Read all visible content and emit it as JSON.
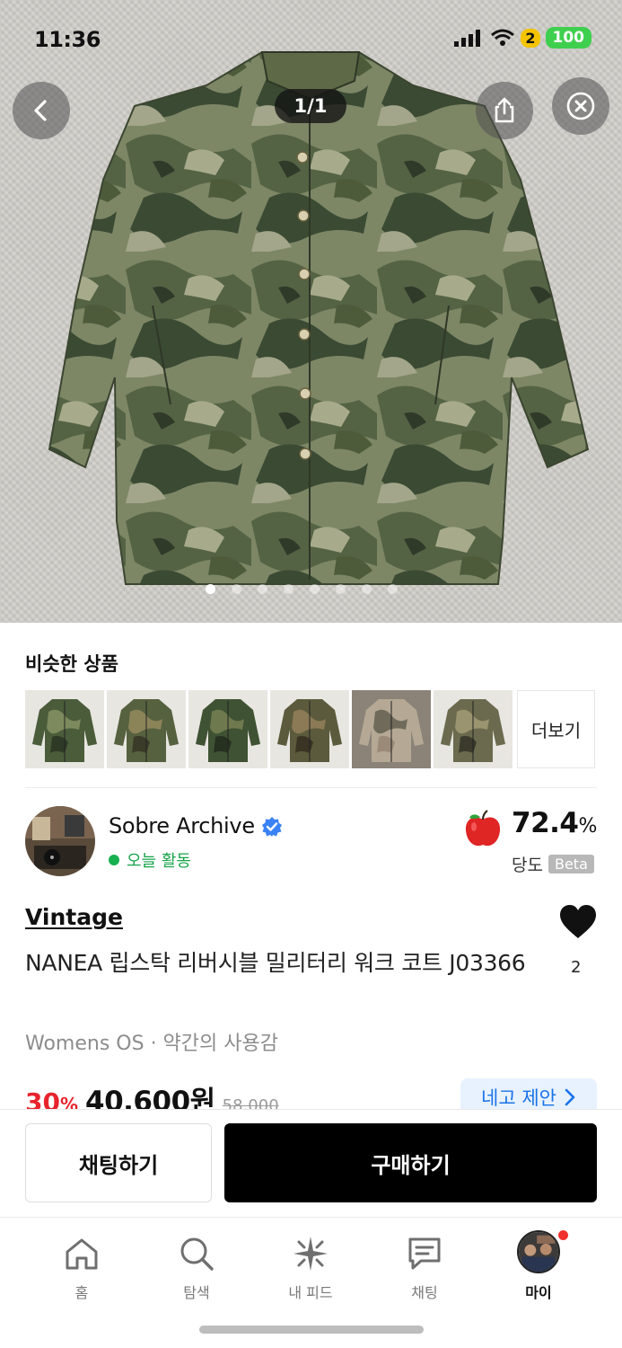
{
  "status_bar": {
    "time": "11:36",
    "battery": "100",
    "charge_badge": "2"
  },
  "gallery": {
    "counter": "1/1",
    "dots_total": 8,
    "active_dot": 0
  },
  "similar": {
    "title": "비슷한 상품",
    "more_label": "더보기",
    "thumb_colors": [
      [
        "#4a5c3a",
        "#7d8a5d",
        "#2f3a26"
      ],
      [
        "#56613f",
        "#8c8459",
        "#3a3b28"
      ],
      [
        "#3f5233",
        "#6e7a4e",
        "#273120"
      ],
      [
        "#5b5a3c",
        "#8b7a55",
        "#3a3424"
      ],
      [
        "#b5a995",
        "#6f6a5a",
        "#9c8a78"
      ],
      [
        "#6b6a4e",
        "#9a9470",
        "#3b3a2c"
      ]
    ]
  },
  "seller": {
    "name": "Sobre Archive",
    "activity": "오늘 활동",
    "score": "72.4",
    "score_unit": "%",
    "score_label": "당도",
    "beta": "Beta"
  },
  "product": {
    "brand": "Vintage",
    "title": "NANEA 립스탁 리버시블 밀리터리 워크 코트 J03366",
    "meta": "Womens OS · 약간의 사용감",
    "likes": "2",
    "discount": "30",
    "discount_unit": "%",
    "price": "40,600원",
    "original_price": "58,000",
    "offer_label": "네고 제안"
  },
  "actions": {
    "chat_label": "채팅하기",
    "buy_label": "구매하기"
  },
  "tabs": [
    {
      "label": "홈",
      "icon": "home-icon"
    },
    {
      "label": "탐색",
      "icon": "search-icon"
    },
    {
      "label": "내 피드",
      "icon": "sparkle-icon"
    },
    {
      "label": "채팅",
      "icon": "chat-icon"
    },
    {
      "label": "마이",
      "icon": "profile-avatar"
    }
  ]
}
